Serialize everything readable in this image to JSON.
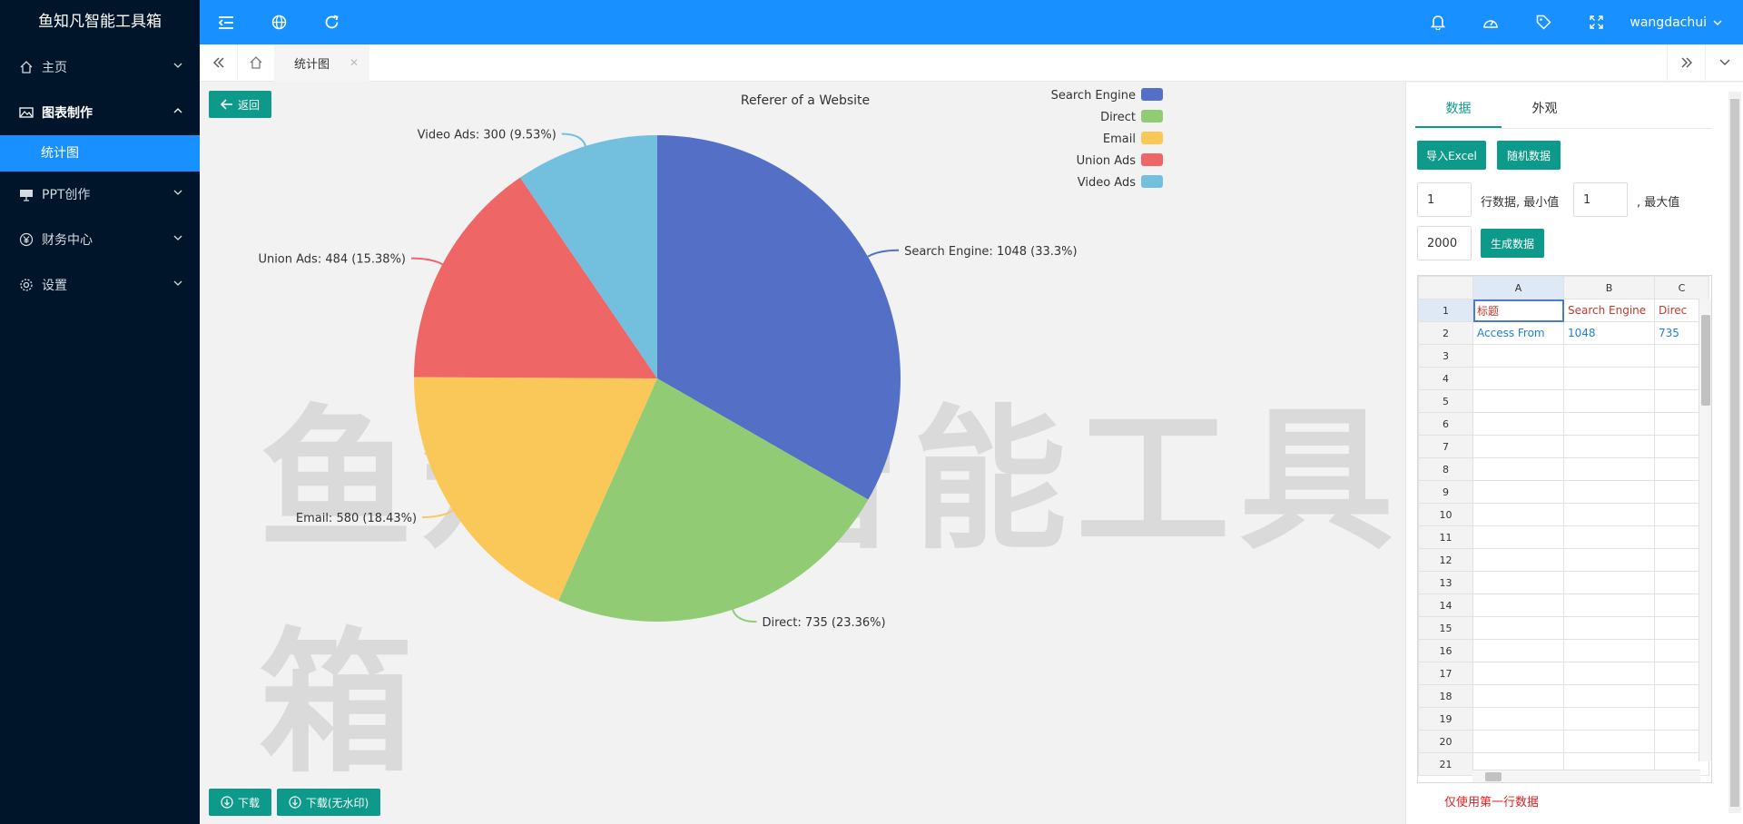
{
  "app": {
    "title": "鱼知凡智能工具箱"
  },
  "sidebar": {
    "items": [
      {
        "label": "主页",
        "icon": "home-icon"
      },
      {
        "label": "图表制作",
        "icon": "image-icon",
        "open": true,
        "children": [
          {
            "label": "统计图",
            "active": true
          }
        ]
      },
      {
        "label": "PPT创作",
        "icon": "presentation-icon"
      },
      {
        "label": "财务中心",
        "icon": "yen-icon"
      },
      {
        "label": "设置",
        "icon": "gear-icon"
      }
    ]
  },
  "topbar": {
    "left_icons": [
      "menu-fold-icon",
      "globe-icon",
      "refresh-icon"
    ],
    "right_icons": [
      "bell-icon",
      "dashboard-icon",
      "tag-icon",
      "fullscreen-icon"
    ],
    "user": "wangdachui"
  },
  "tabs": {
    "active_label": "统计图"
  },
  "chart_area": {
    "back_label": "返回",
    "download_label": "下载",
    "download_nowm_label": "下载(无水印)",
    "watermark_text": "鱼知凡智能工具箱"
  },
  "chart_data": {
    "type": "pie",
    "title": "Referer of a Website",
    "categories": [
      "Search Engine",
      "Direct",
      "Email",
      "Union Ads",
      "Video Ads"
    ],
    "values": [
      1048,
      735,
      580,
      484,
      300
    ],
    "labels": [
      "Search Engine: 1048 (33.3%)",
      "Direct: 735 (23.36%)",
      "Email: 580 (18.43%)",
      "Union Ads: 484 (15.38%)",
      "Video Ads: 300 (9.53%)"
    ],
    "colors": [
      "#5470c6",
      "#91cc75",
      "#fac858",
      "#ee6666",
      "#73c0de"
    ],
    "legend": "top-right"
  },
  "right_panel": {
    "tabs": [
      "数据",
      "外观"
    ],
    "active_tab": "数据",
    "import_label": "导入Excel",
    "random_label": "随机数据",
    "rows_value": "1",
    "rows_text": "行数据, 最小值",
    "min_value": "1",
    "max_text": ", 最大值",
    "max_value": "2000",
    "generate_label": "生成数据",
    "note": "仅使用第一行数据"
  },
  "sheet": {
    "columns": [
      "A",
      "B",
      "C"
    ],
    "row1": [
      "标题",
      "Search Engine",
      "Direc"
    ],
    "row2": [
      "Access From",
      "1048",
      "735"
    ],
    "row_numbers": [
      "1",
      "2",
      "3",
      "4",
      "5",
      "6",
      "7",
      "8",
      "9",
      "10",
      "11",
      "12",
      "13",
      "14",
      "15",
      "16",
      "17",
      "18",
      "19",
      "20",
      "21"
    ]
  }
}
